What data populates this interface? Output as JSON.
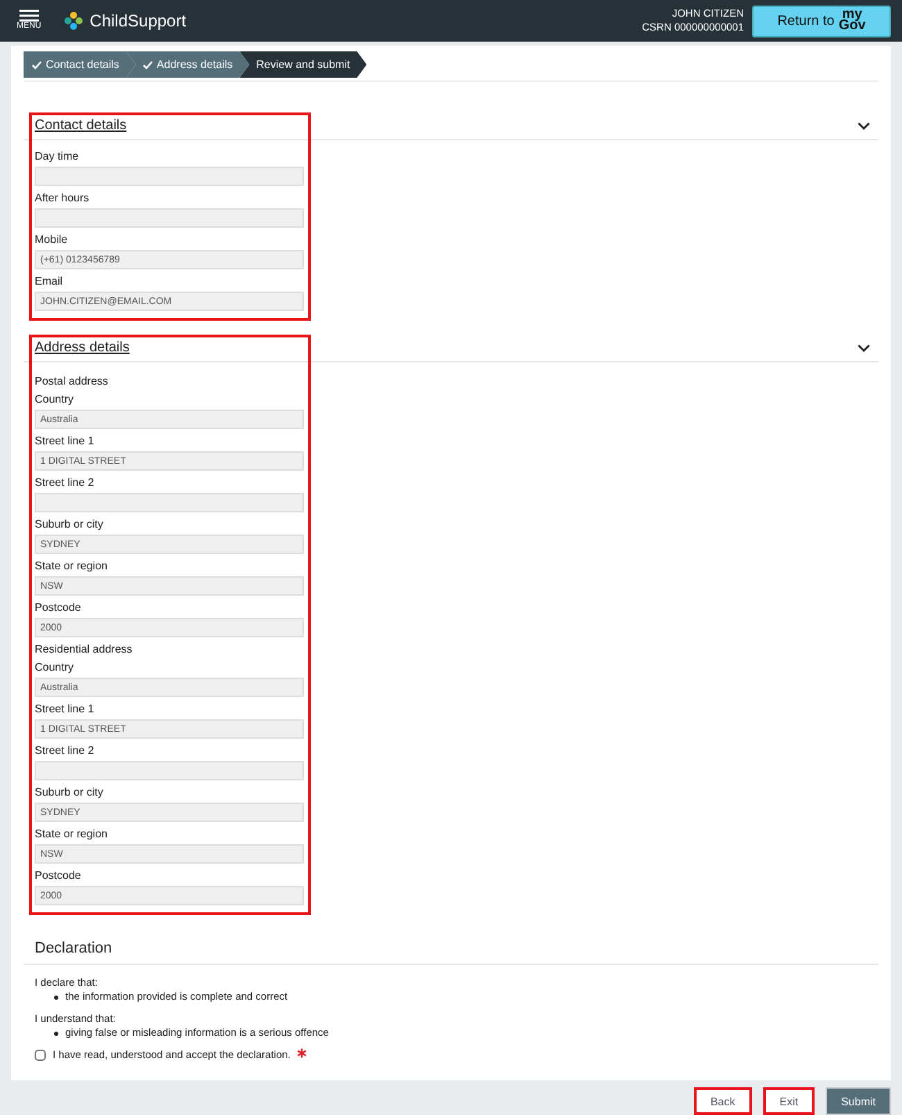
{
  "header": {
    "menu_label": "MENU",
    "brand": "ChildSupport",
    "user_name": "JOHN CITIZEN",
    "csrn": "CSRN 000000000001",
    "return_button": {
      "text": "Return to",
      "logo_top": "my",
      "logo_bottom": "Gov"
    }
  },
  "steps": [
    {
      "label": "Contact details",
      "completed": true,
      "selected": false
    },
    {
      "label": "Address details",
      "completed": true,
      "selected": false
    },
    {
      "label": "Review and submit",
      "completed": false,
      "selected": true
    }
  ],
  "sections": [
    {
      "title": "Contact details",
      "highlighted": true,
      "expanded": true,
      "items": [
        {
          "kind": "field",
          "label": "Day time",
          "value": ""
        },
        {
          "kind": "field",
          "label": "After hours",
          "value": ""
        },
        {
          "kind": "field",
          "label": "Mobile",
          "value": "(+61) 0123456789"
        },
        {
          "kind": "field",
          "label": "Email",
          "value": "JOHN.CITIZEN@EMAIL.COM"
        }
      ]
    },
    {
      "title": "Address details",
      "highlighted": true,
      "expanded": true,
      "items": [
        {
          "kind": "subheading",
          "text": "Postal address"
        },
        {
          "kind": "field",
          "label": "Country",
          "value": "Australia"
        },
        {
          "kind": "field",
          "label": "Street line 1",
          "value": "1 DIGITAL STREET"
        },
        {
          "kind": "field",
          "label": "Street line 2",
          "value": ""
        },
        {
          "kind": "field",
          "label": "Suburb or city",
          "value": "SYDNEY"
        },
        {
          "kind": "field",
          "label": "State or region",
          "value": "NSW"
        },
        {
          "kind": "field",
          "label": "Postcode",
          "value": "2000"
        },
        {
          "kind": "subheading",
          "text": "Residential address"
        },
        {
          "kind": "field",
          "label": "Country",
          "value": "Australia"
        },
        {
          "kind": "field",
          "label": "Street line 1",
          "value": "1 DIGITAL STREET"
        },
        {
          "kind": "field",
          "label": "Street line 2",
          "value": ""
        },
        {
          "kind": "field",
          "label": "Suburb or city",
          "value": "SYDNEY"
        },
        {
          "kind": "field",
          "label": "State or region",
          "value": "NSW"
        },
        {
          "kind": "field",
          "label": "Postcode",
          "value": "2000"
        }
      ]
    }
  ],
  "declaration": {
    "title": "Declaration",
    "groups": [
      {
        "intro": "I declare that:",
        "bullets": [
          "the information provided is complete and correct"
        ]
      },
      {
        "intro": "I understand that:",
        "bullets": [
          "giving false or misleading information is a serious offence"
        ]
      }
    ],
    "checkbox": {
      "label": "I have read, understood and accept the declaration.",
      "checked": false,
      "required": true
    }
  },
  "buttons": [
    {
      "label": "Back",
      "kind": "secondary",
      "highlighted": true
    },
    {
      "label": "Exit",
      "kind": "secondary",
      "highlighted": true
    },
    {
      "label": "Submit",
      "kind": "primary",
      "highlighted": false
    }
  ]
}
